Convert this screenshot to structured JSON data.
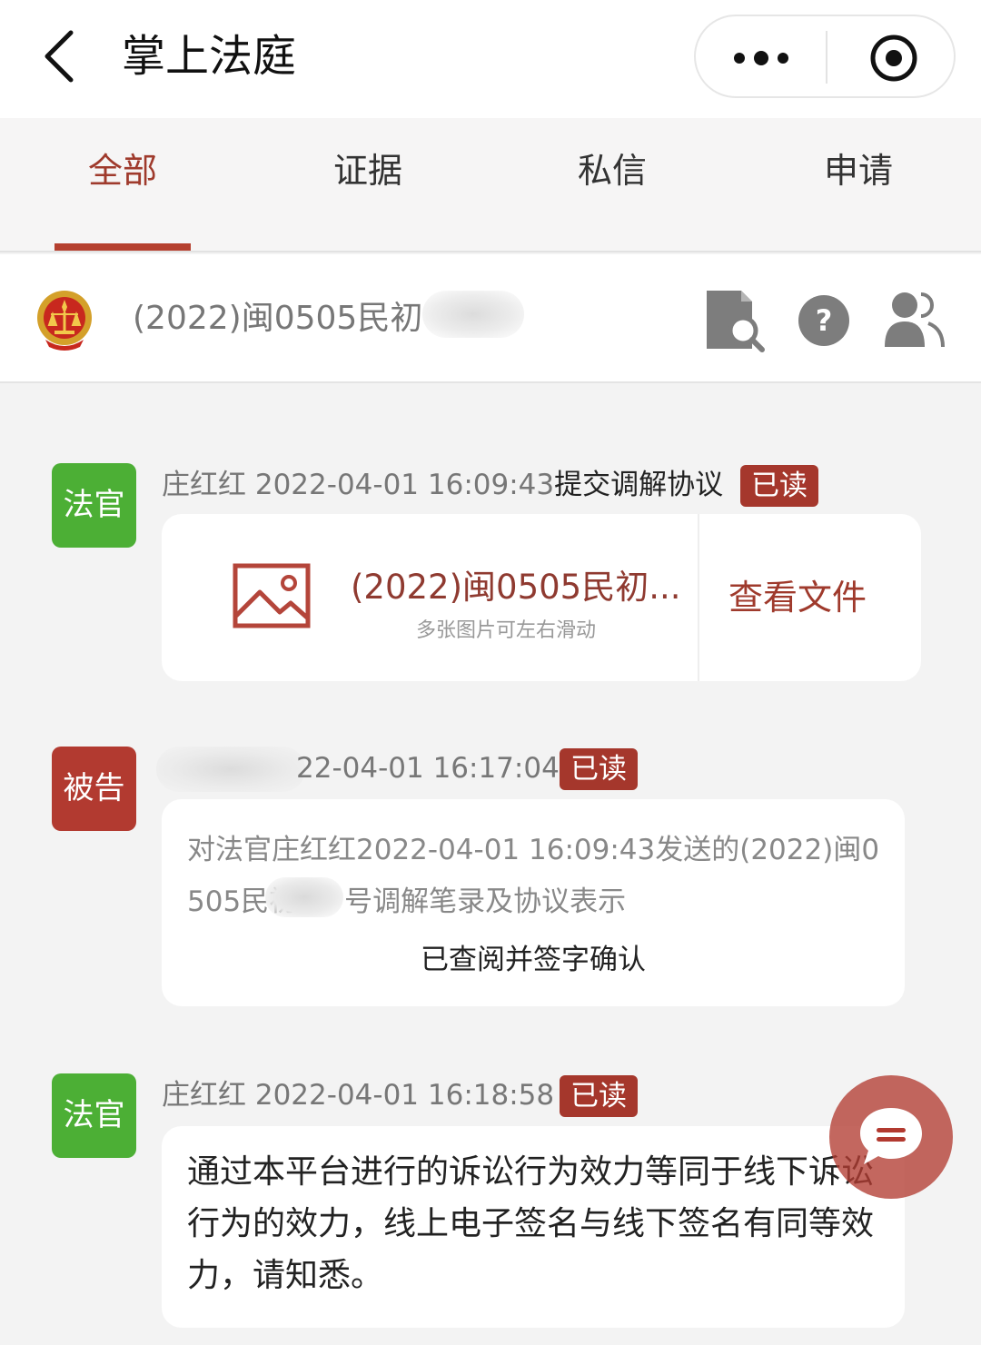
{
  "header": {
    "title": "掌上法庭"
  },
  "tabs": [
    {
      "label": "全部",
      "active": true
    },
    {
      "label": "证据",
      "active": false
    },
    {
      "label": "私信",
      "active": false
    },
    {
      "label": "申请",
      "active": false
    }
  ],
  "case": {
    "title": "(2022)闽0505民初"
  },
  "messages": [
    {
      "role": "法官",
      "sender": "庄红红",
      "time": "2022-04-01 16:09:43",
      "action": "提交调解协议",
      "status": "已读",
      "file": {
        "name": "(2022)闽0505民初...",
        "hint": "多张图片可左右滑动",
        "view_label": "查看文件"
      }
    },
    {
      "role": "被告",
      "time_visible": "22-04-01 16:17:04",
      "status": "已读",
      "text_line1": "对法官庄红红2022-04-01 16:09:43发送的(2022)闽0",
      "text_line2_a": "505民初",
      "text_line2_b": "号调解笔录及协议表示",
      "confirm": "已查阅并签字确认"
    },
    {
      "role": "法官",
      "sender": "庄红红",
      "time": "2022-04-01 16:18:58",
      "status": "已读",
      "text": "通过本平台进行的诉讼行为效力等同于线下诉讼行为的效力，线上电子签名与线下签名有同等效力，请知悉。"
    }
  ],
  "colors": {
    "accent": "#9f3a2c",
    "judge_badge": "#4caf35",
    "defendant_badge": "#b23a30",
    "read_badge": "#a5372c"
  }
}
